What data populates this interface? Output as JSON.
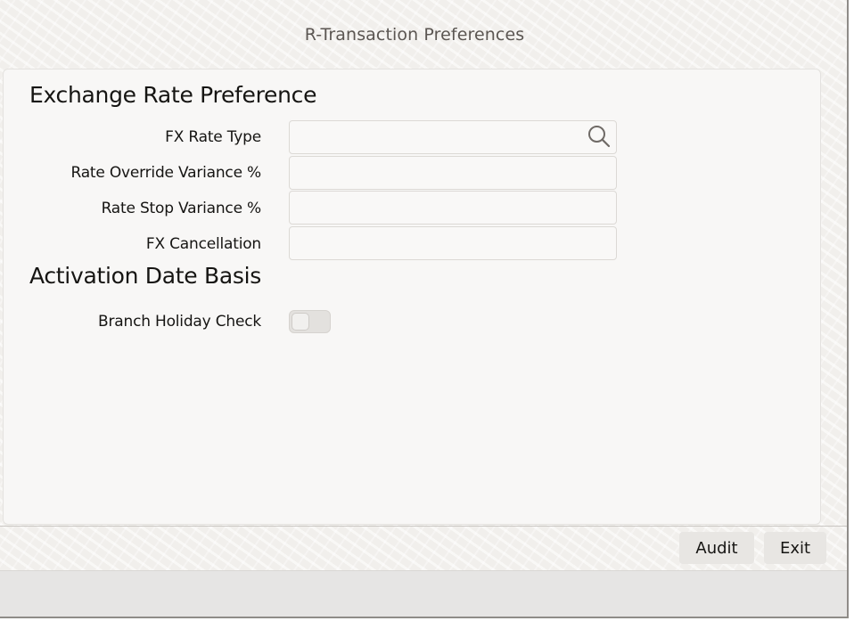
{
  "window": {
    "title": "R-Transaction Preferences"
  },
  "exchange_rate": {
    "heading": "Exchange Rate Preference",
    "fx_rate_type": {
      "label": "FX Rate Type",
      "value": ""
    },
    "rate_override_variance": {
      "label": "Rate Override Variance %",
      "value": ""
    },
    "rate_stop_variance": {
      "label": "Rate Stop Variance %",
      "value": ""
    },
    "fx_cancellation": {
      "label": "FX Cancellation",
      "value": ""
    }
  },
  "activation": {
    "heading": "Activation Date Basis",
    "branch_holiday_check": {
      "label": "Branch Holiday Check",
      "checked": false
    }
  },
  "footer": {
    "audit_label": "Audit",
    "exit_label": "Exit"
  },
  "icons": {
    "lookup": "search-icon"
  },
  "colors": {
    "panel": "#f8f7f6",
    "button": "#e8e6e3",
    "text": "#161513"
  }
}
